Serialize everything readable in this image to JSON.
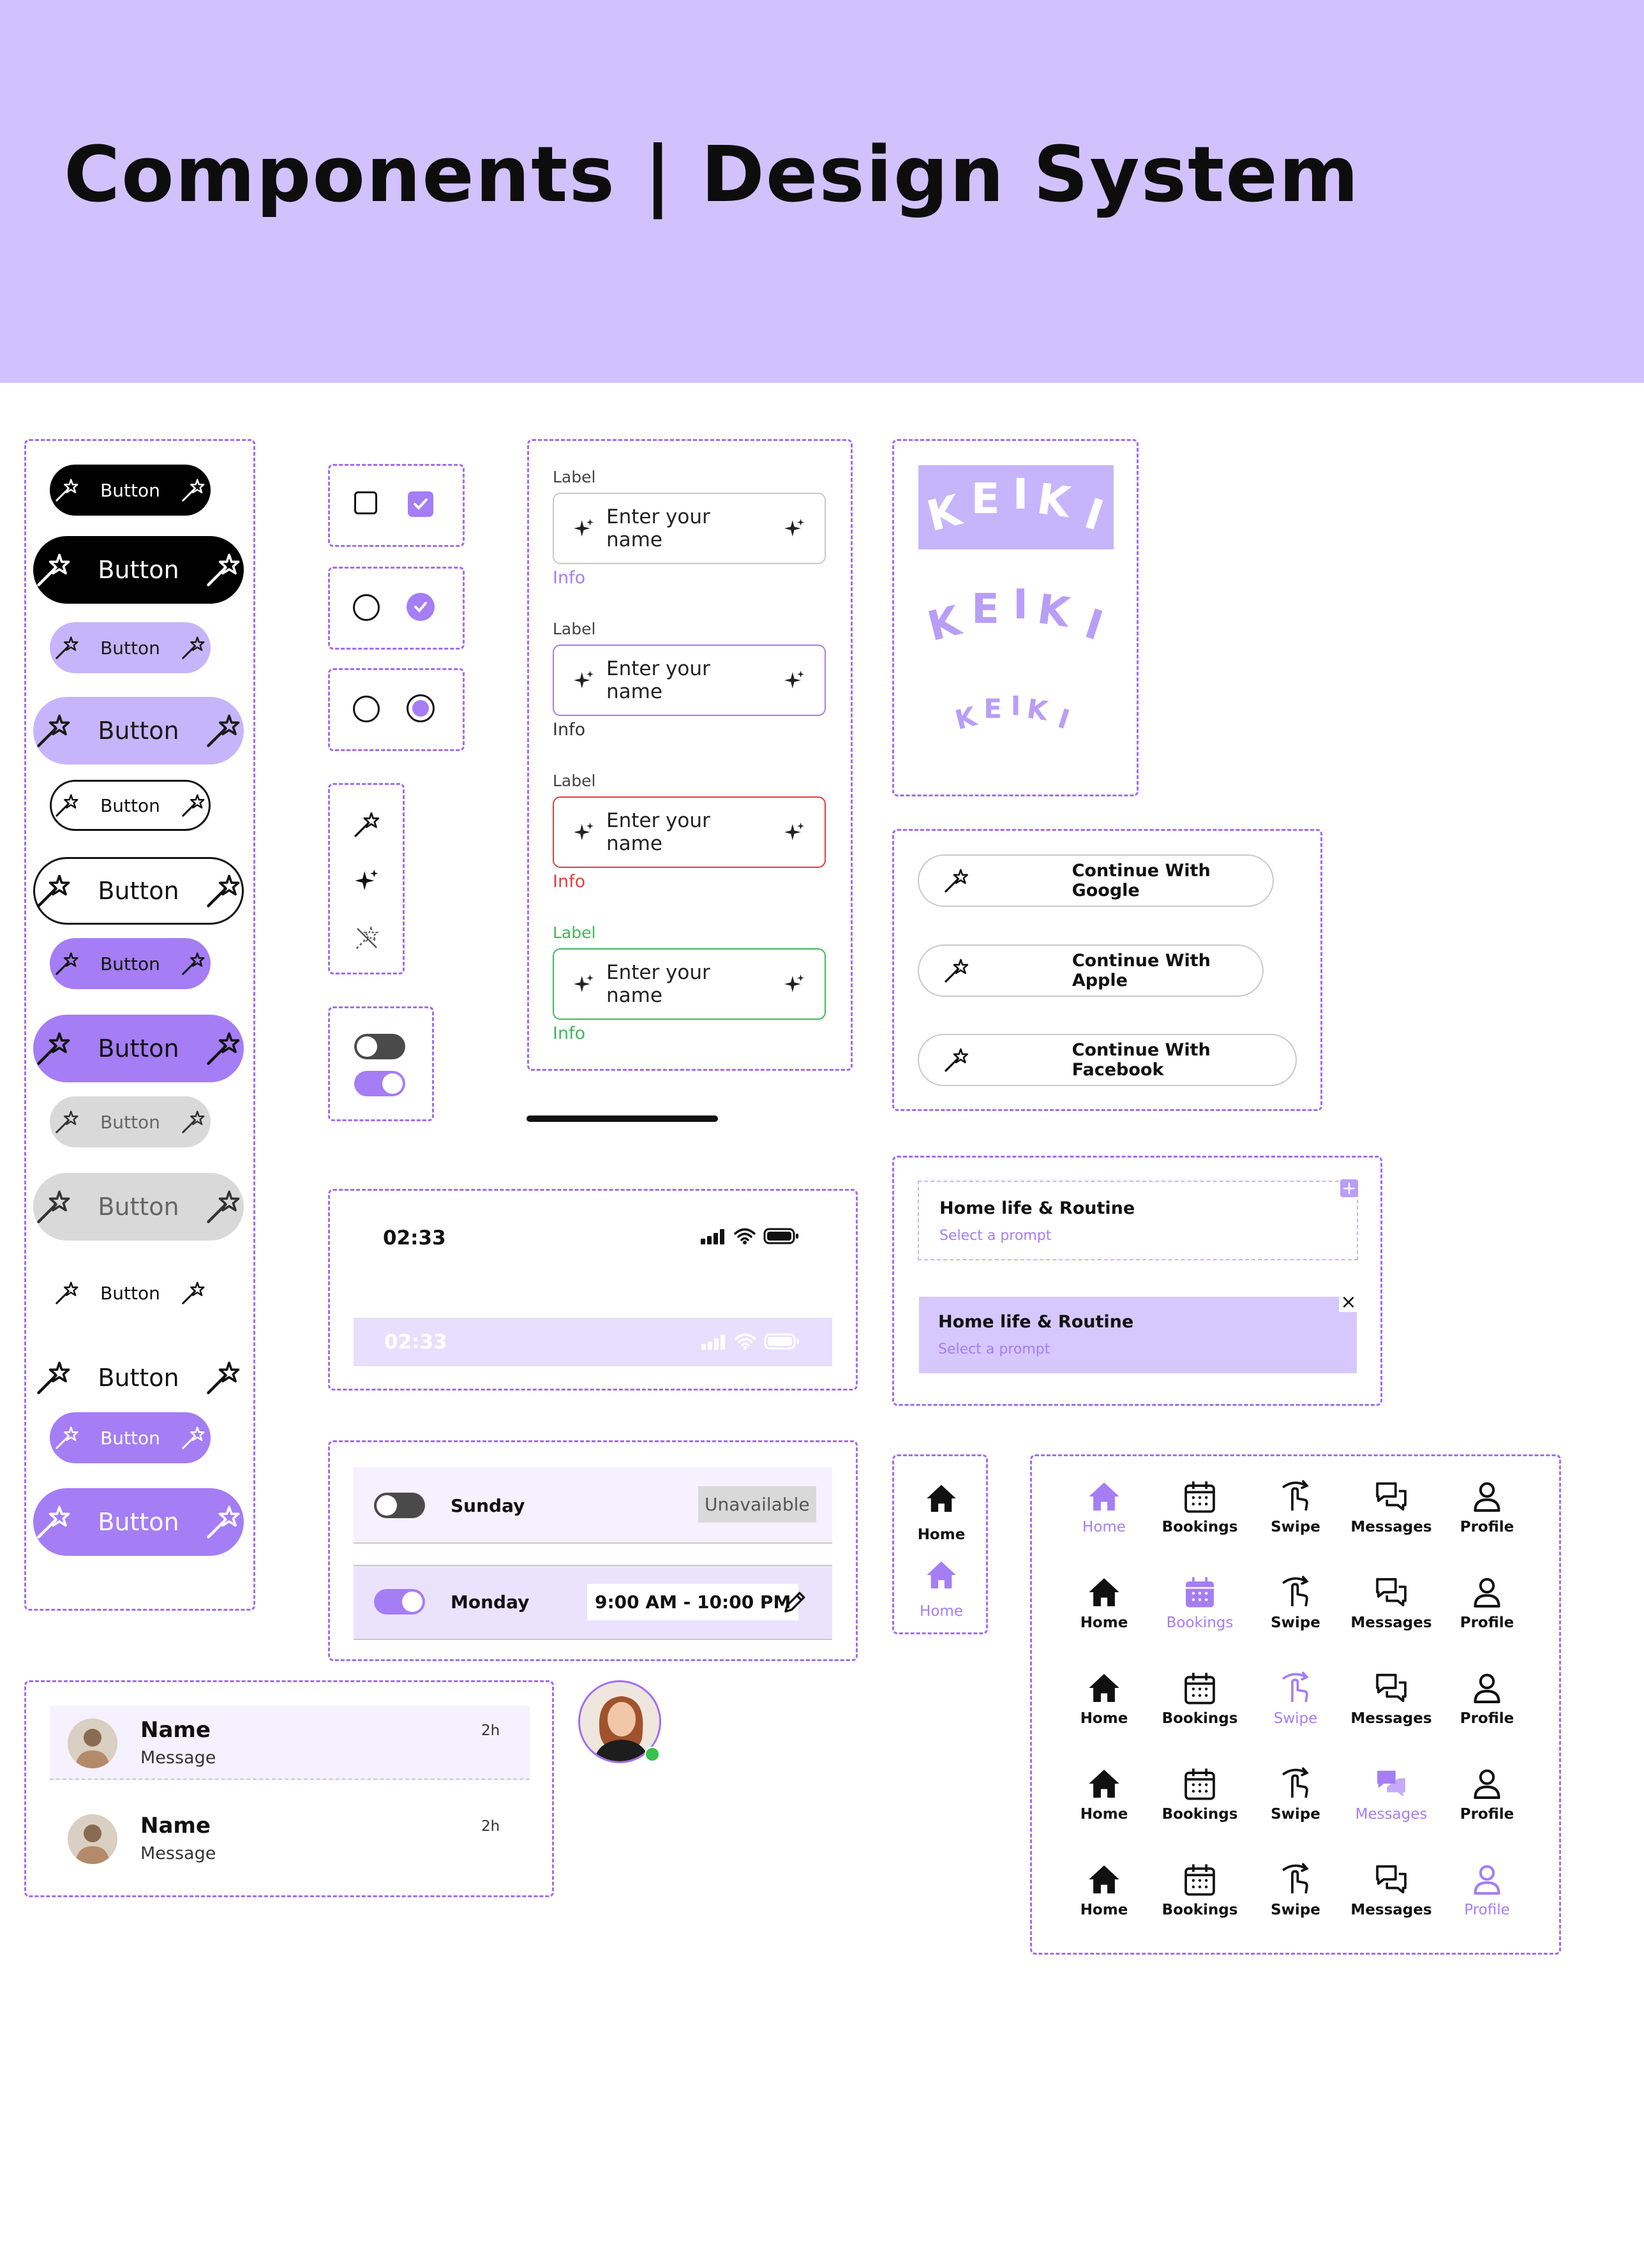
{
  "header": {
    "title": "Components | Design System",
    "bg": "#d1c2fd"
  },
  "colors": {
    "accent": "#a57df5",
    "accent_light": "#c7b5fb",
    "frame": "#a06cf2",
    "error": "#e0403f",
    "success": "#3fb85b"
  },
  "buttons": {
    "label": "Button"
  },
  "inputs": {
    "label": "Label",
    "placeholder": "Enter your name",
    "info": "Info"
  },
  "brand": {
    "logo": "KEIKI"
  },
  "social": {
    "google": "Continue With Google",
    "apple": "Continue With Apple",
    "facebook": "Continue With Facebook"
  },
  "prompt": {
    "title": "Home life & Routine",
    "hint": "Select a prompt"
  },
  "status_bar": {
    "time": "02:33"
  },
  "availability": {
    "sunday": {
      "day": "Sunday",
      "status": "Unavailable"
    },
    "monday": {
      "day": "Monday",
      "hours": "9:00 AM - 10:00 PM"
    }
  },
  "nav": {
    "home": "Home",
    "bookings": "Bookings",
    "swipe": "Swipe",
    "messages": "Messages",
    "profile": "Profile"
  },
  "chat": {
    "name": "Name",
    "message": "Message",
    "time": "2h"
  }
}
